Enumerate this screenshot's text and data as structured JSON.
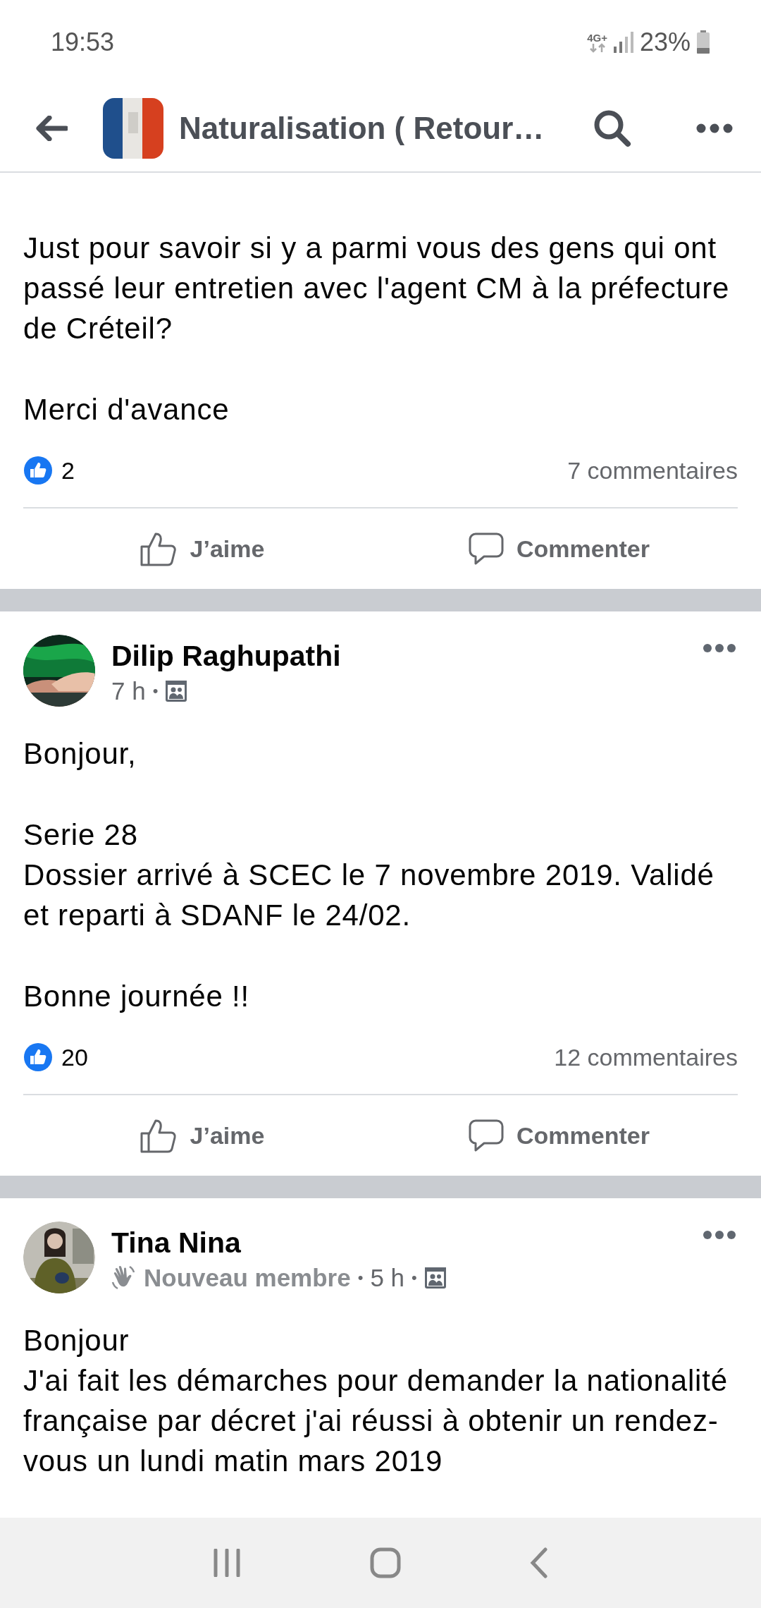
{
  "status_bar": {
    "time": "19:53",
    "network": "4G+",
    "battery": "23%"
  },
  "app_bar": {
    "title": "Naturalisation ( Retour…"
  },
  "posts": [
    {
      "body": [
        [
          "Just pour savoir si y a parmi vous des gens qui ont passé leur entretien avec l'agent CM à la préfecture de Créteil?"
        ],
        [
          "Merci d'avance"
        ]
      ],
      "likes": "2",
      "comments": "7 commentaires",
      "actions": [
        "J’aime",
        "Commenter"
      ]
    },
    {
      "author": "Dilip Raghupathi",
      "meta": [
        {
          "kind": "time",
          "text": "7 h"
        },
        {
          "kind": "sep",
          "text": "•"
        },
        {
          "kind": "audience"
        }
      ],
      "body": [
        [
          "Bonjour,"
        ],
        [
          "Serie 28",
          "Dossier arrivé à SCEC le 7 novembre 2019. Validé et reparti à SDANF le 24/02."
        ],
        [
          "Bonne journée !!"
        ]
      ],
      "likes": "20",
      "comments": "12 commentaires",
      "actions": [
        "J’aime",
        "Commenter"
      ]
    },
    {
      "author": "Tina Nina",
      "meta": [
        {
          "kind": "badge",
          "text": "Nouveau membre"
        },
        {
          "kind": "sep",
          "text": "•"
        },
        {
          "kind": "time",
          "text": "5 h"
        },
        {
          "kind": "sep",
          "text": "•"
        },
        {
          "kind": "audience"
        }
      ],
      "body": [
        [
          "Bonjour",
          "J'ai fait les démarches pour demander la nationalité française par décret j'ai réussi à obtenir un rendez-vous un lundi matin mars 2019"
        ]
      ]
    }
  ]
}
